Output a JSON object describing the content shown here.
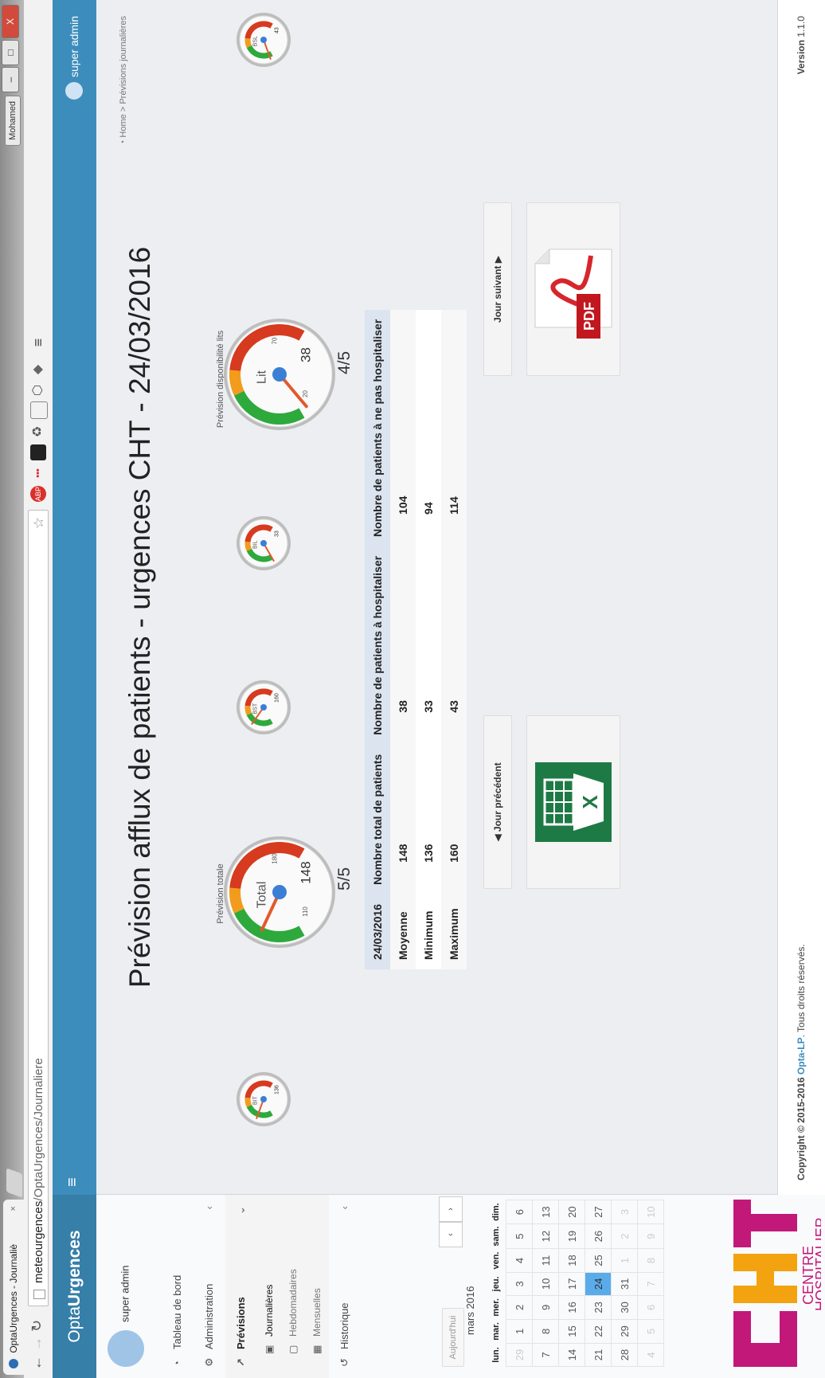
{
  "browser": {
    "tab_title": "OptaUrgences - Journaliè",
    "tab_close": "×",
    "url_host": "meteourgences",
    "url_path": "/OptaUrgences/Journaliere",
    "user_chip": "Mohamed",
    "window_buttons": [
      "–",
      "□",
      "X"
    ],
    "extensions": [
      "ABP",
      "•••"
    ]
  },
  "app": {
    "logo_light": "Opta",
    "logo_bold": "Urgences",
    "header_user": "super admin"
  },
  "sidebar": {
    "user_name": "super admin",
    "items": [
      {
        "label": "Tableau de bord",
        "icon": "dashboard-icon"
      },
      {
        "label": "Administration",
        "icon": "gears-icon",
        "chevron": "‹"
      },
      {
        "label": "Prévisions",
        "icon": "line-chart-icon",
        "chevron": "‹"
      }
    ],
    "sub_items": [
      {
        "label": "Journalières",
        "icon": "calendar-icon"
      },
      {
        "label": "Hebdomadaires",
        "icon": "calendar-icon"
      },
      {
        "label": "Mensuelles",
        "icon": "calendar-grid-icon"
      }
    ],
    "history": {
      "label": "Historique",
      "icon": "history-icon",
      "chevron": "‹"
    }
  },
  "calendar": {
    "today_button": "Aujourd'hui",
    "prev": "‹",
    "next": "›",
    "month_label": "mars 2016",
    "weekdays": [
      "lun.",
      "mar.",
      "mer.",
      "jeu.",
      "ven.",
      "sam.",
      "dim."
    ],
    "weeks": [
      [
        "29",
        "1",
        "2",
        "3",
        "4",
        "5",
        "6"
      ],
      [
        "7",
        "8",
        "9",
        "10",
        "11",
        "12",
        "13"
      ],
      [
        "14",
        "15",
        "16",
        "17",
        "18",
        "19",
        "20"
      ],
      [
        "21",
        "22",
        "23",
        "24",
        "25",
        "26",
        "27"
      ],
      [
        "28",
        "29",
        "30",
        "31",
        "1",
        "2",
        "3"
      ],
      [
        "4",
        "5",
        "6",
        "7",
        "8",
        "9",
        "10"
      ]
    ],
    "selected_day": "24"
  },
  "main": {
    "breadcrumb_home": "Home",
    "breadcrumb_sep": ">",
    "breadcrumb_current": "Prévisions journalières",
    "title": "Prévision afflux de patients - urgences CHT - 24/03/2016",
    "gauge_total_label": "Prévision totale",
    "gauge_beds_label": "Prévision disponibilité lits",
    "gauge_total": {
      "center": "Total",
      "value": "148",
      "t1": "110",
      "t2": "180"
    },
    "gauge_beds": {
      "center": "Lit",
      "value": "38",
      "t1": "20",
      "t2": "70"
    },
    "mini_gauges": [
      {
        "center": "BIT",
        "value": "136"
      },
      {
        "center": "BST",
        "value": "160"
      },
      {
        "center": "BIL",
        "value": "33"
      },
      {
        "center": "BSL",
        "value": "43"
      }
    ],
    "score_total": "5/5",
    "score_beds": "4/5",
    "table": {
      "headers": [
        "24/03/2016",
        "Nombre total de patients",
        "Nombre de patients à hospitaliser",
        "Nombre de patients à ne pas hospitaliser"
      ],
      "rows": [
        [
          "Moyenne",
          "148",
          "38",
          "104"
        ],
        [
          "Minimum",
          "136",
          "33",
          "94"
        ],
        [
          "Maximum",
          "160",
          "43",
          "114"
        ]
      ]
    },
    "prev_day_button": "Jour précédent",
    "next_day_button": "Jour suivant",
    "excel_icon": "excel-icon",
    "pdf_icon": "pdf-icon",
    "pdf_text": "PDF"
  },
  "footer": {
    "copyright_prefix": "Copyright © 2015-2016",
    "company": "Opta-LP",
    "copyright_suffix": ". Tous droits réservés.",
    "version_label": "Version",
    "version": "1.1.0"
  },
  "logo": {
    "text1": "CENTRE",
    "text2": "HOSPITALIER"
  },
  "colors": {
    "header": "#3c8dbc",
    "logo_bg": "#367fa9",
    "gauge_green": "#2ea93c",
    "gauge_orange": "#f29b1d",
    "gauge_red": "#d63a1f",
    "needle": "#e25a2b",
    "hub": "#3a7fd5"
  }
}
